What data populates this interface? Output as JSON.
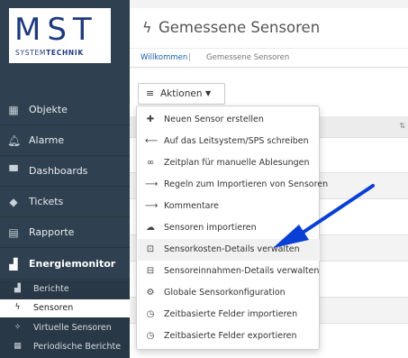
{
  "logo": {
    "name": "MST",
    "tagline_part1": "SYSTEM",
    "tagline_part2": "TECHNIK"
  },
  "sidebar": {
    "items": [
      {
        "label": "Objekte",
        "icon": "building-icon"
      },
      {
        "label": "Alarme",
        "icon": "bell-icon"
      },
      {
        "label": "Dashboards",
        "icon": "dashboard-icon"
      },
      {
        "label": "Tickets",
        "icon": "ticket-icon"
      },
      {
        "label": "Rapporte",
        "icon": "document-icon"
      },
      {
        "label": "Energiemonitor",
        "icon": "bar-chart-icon"
      }
    ],
    "subitems": [
      {
        "label": "Berichte",
        "icon": "bar-chart-small-icon"
      },
      {
        "label": "Sensoren",
        "icon": "bolt-icon"
      },
      {
        "label": "Virtuelle Sensoren",
        "icon": "magic-wand-icon"
      },
      {
        "label": "Periodische Berichte",
        "icon": "table-icon"
      }
    ]
  },
  "header": {
    "title": "Gemessene Sensoren"
  },
  "breadcrumb": {
    "home": "Willkommen",
    "separator": "|",
    "current": "Gemessene Sensoren"
  },
  "actions": {
    "label": "Aktionen"
  },
  "dropdown": {
    "items": [
      {
        "label": "Neuen Sensor erstellen",
        "icon": "plus-icon"
      },
      {
        "label": "Auf das Leitsystem/SPS schreiben",
        "icon": "arrow-left-icon"
      },
      {
        "label": "Zeitplan für manuelle Ablesungen",
        "icon": "glasses-icon"
      },
      {
        "label": "Regeln zum Importieren von Sensoren",
        "icon": "arrow-right-icon"
      },
      {
        "label": "Kommentare",
        "icon": "arrow-right-icon"
      },
      {
        "label": "Sensoren importieren",
        "icon": "cloud-upload-icon"
      },
      {
        "label": "Sensorkosten-Details verwalten",
        "icon": "box-arrow-right-icon"
      },
      {
        "label": "Sensoreinnahmen-Details verwalten",
        "icon": "box-arrow-left-icon"
      },
      {
        "label": "Globale Sensorkonfiguration",
        "icon": "gear-icon"
      },
      {
        "label": "Zeitbasierte Felder importieren",
        "icon": "clock-icon"
      },
      {
        "label": "Zeitbasierte Felder exportieren",
        "icon": "clock-icon"
      }
    ]
  },
  "colors": {
    "sidebar": "#2f4050",
    "accent": "#1a61a8",
    "arrow": "#0a3fd6"
  }
}
